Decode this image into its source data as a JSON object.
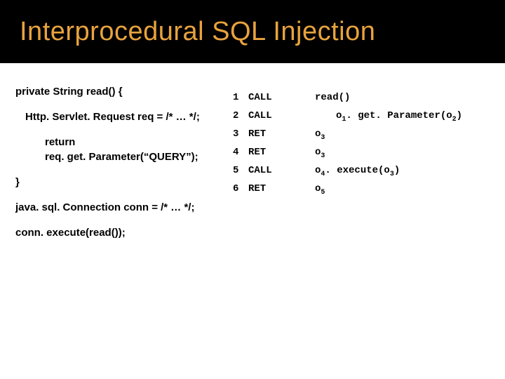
{
  "title": "Interprocedural SQL Injection",
  "code": {
    "l1": "private String read() {",
    "l2": "Http. Servlet. Request req = /* … */;",
    "l3a": "return",
    "l3b": "req. get. Parameter(“QUERY”);",
    "l4": "}",
    "l5": "java. sql. Connection conn = /* … */;",
    "l6": "conn. execute(read());"
  },
  "linenos": [
    "1",
    "2",
    "3",
    "4",
    "5",
    "6"
  ],
  "trace": {
    "r1": {
      "op": "CALL",
      "arg": "read()"
    },
    "r2": {
      "op": "CALL",
      "arg_prefix": "o",
      "arg_sub1": "1",
      "arg_mid": ". get. Parameter(o",
      "arg_sub2": "2",
      "arg_suffix": ")"
    },
    "r3": {
      "op": "RET",
      "pre": "o",
      "sub": "3",
      "post": ""
    },
    "r4": {
      "op": "RET",
      "pre": "o",
      "sub": "3",
      "post": ""
    },
    "r5": {
      "op": "CALL",
      "pre": "o",
      "sub1": "4",
      "mid": ". execute(o",
      "sub2": "3",
      "post": ")"
    },
    "r6": {
      "op": "RET",
      "pre": "o",
      "sub": "5",
      "post": ""
    }
  }
}
